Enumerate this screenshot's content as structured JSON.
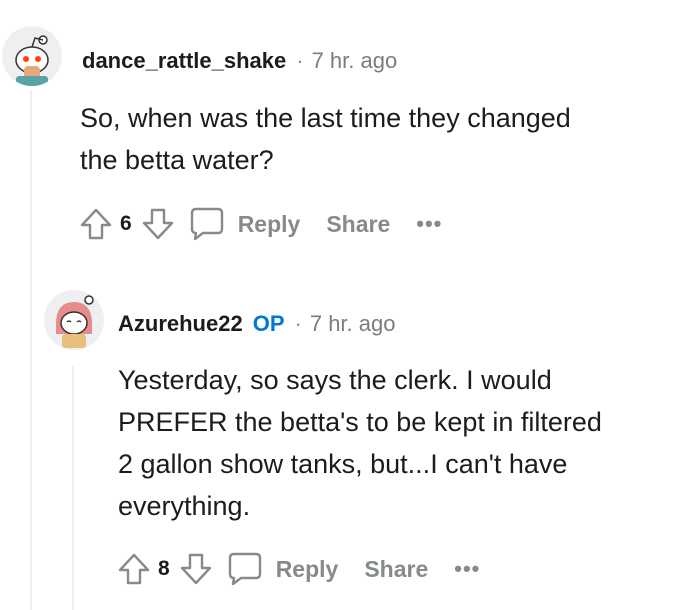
{
  "comments": [
    {
      "username": "dance_rattle_shake",
      "is_op": false,
      "separator": "·",
      "time": "7 hr. ago",
      "body_lines": [
        "So, when was the last time they changed",
        "the betta water?"
      ],
      "score": "6",
      "reply_label": "Reply",
      "share_label": "Share",
      "more_label": "•••"
    },
    {
      "username": "Azurehue22",
      "is_op": true,
      "op_label": "OP",
      "separator": "·",
      "time": "7 hr. ago",
      "body_lines": [
        "Yesterday, so says the clerk. I would",
        "PREFER the betta's to be kept in filtered",
        "2 gallon show tanks, but...I can't have",
        "everything."
      ],
      "score": "8",
      "reply_label": "Reply",
      "share_label": "Share",
      "more_label": "•••"
    }
  ],
  "colors": {
    "op_badge": "#0079d3",
    "muted_text": "#878a8c",
    "thread_line": "#edeff1"
  },
  "icons": [
    "avatar-snoo",
    "upvote-icon",
    "downvote-icon",
    "comment-bubble-icon"
  ]
}
